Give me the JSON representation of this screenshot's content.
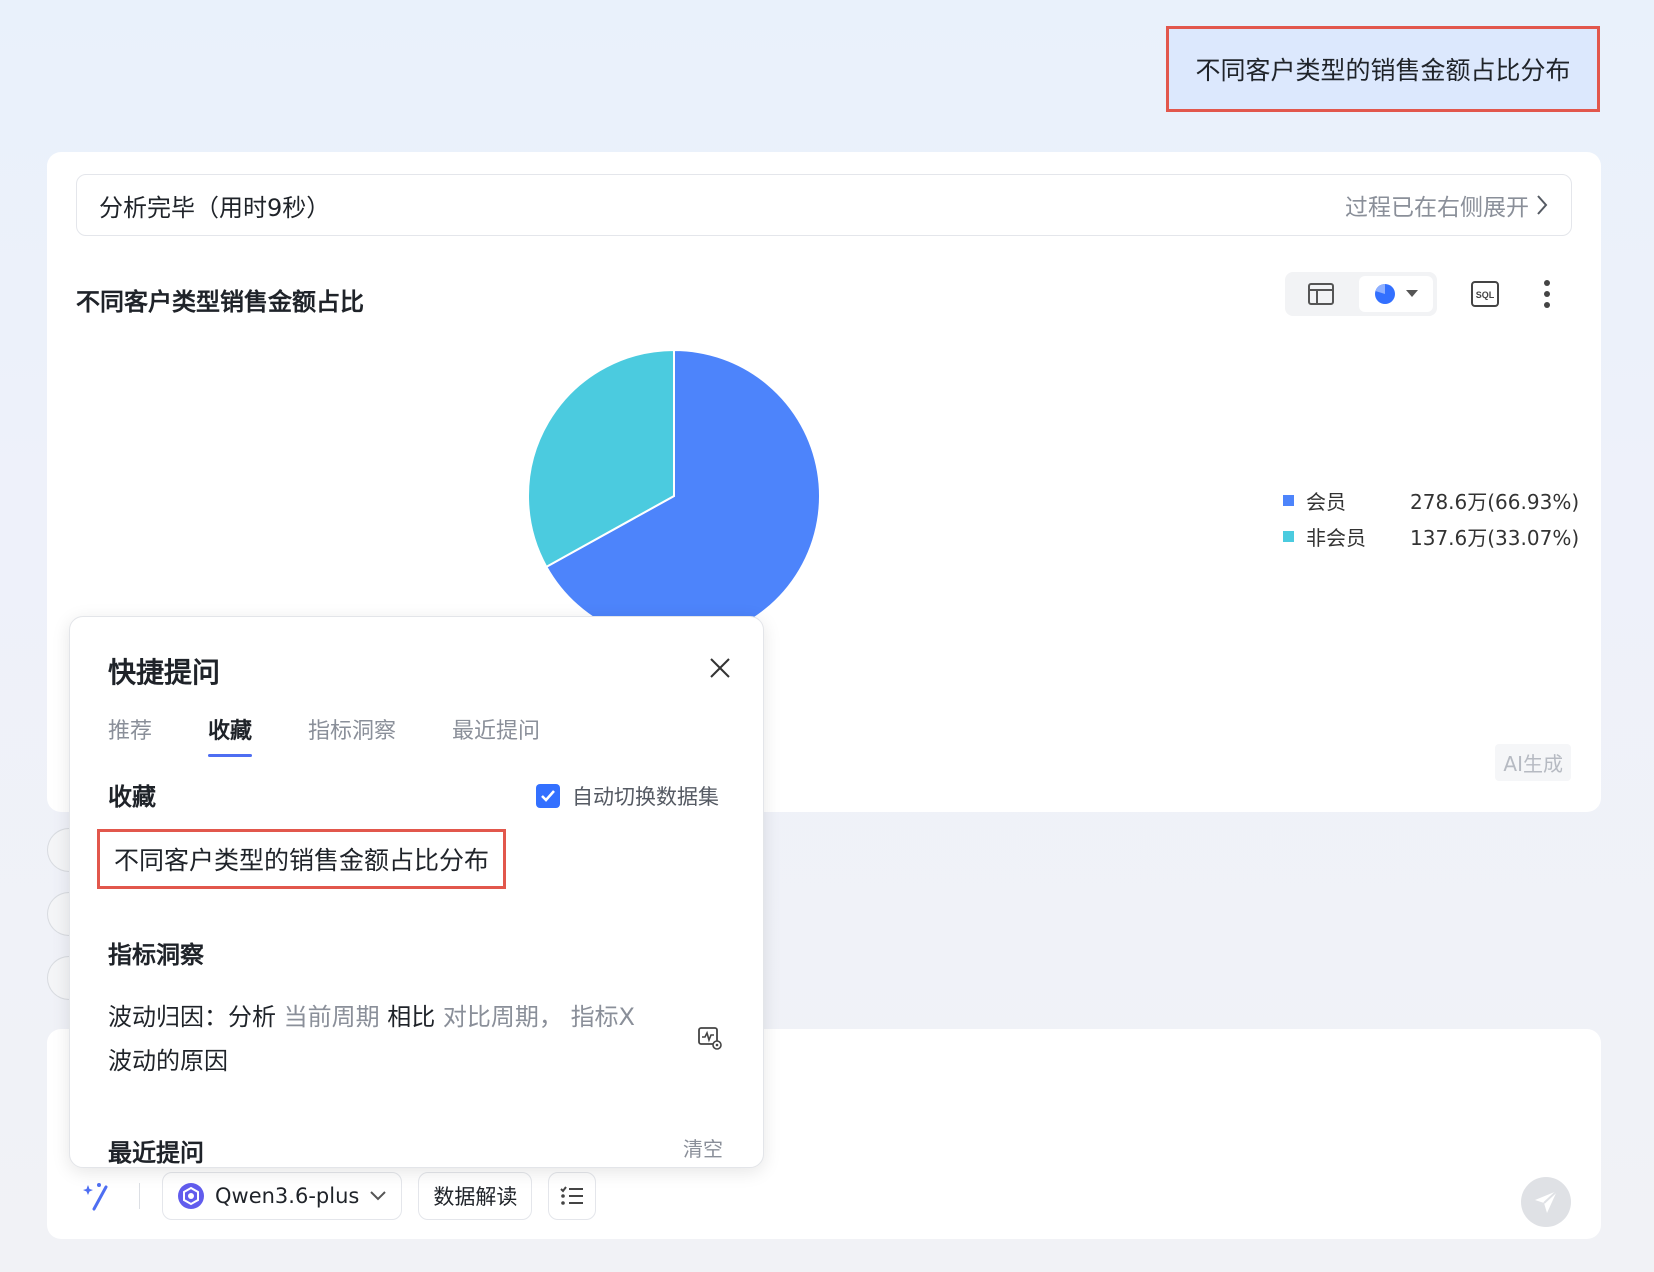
{
  "user_message": "不同客户类型的销售金额占比分布",
  "status": {
    "text": "分析完毕（用时9秒）",
    "link": "过程已在右侧展开"
  },
  "chart": {
    "title": "不同客户类型销售金额占比",
    "sql_label": "SQL",
    "ai_tag": "AI生成"
  },
  "chart_data": {
    "type": "pie",
    "title": "不同客户类型销售金额占比",
    "slices": [
      {
        "name": "会员",
        "value": 278.6,
        "display": "278.6万(66.93%)",
        "percent": 66.93,
        "color": "#4d84fb"
      },
      {
        "name": "非会员",
        "value": 137.6,
        "display": "137.6万(33.07%)",
        "percent": 33.07,
        "color": "#4bcbdf"
      }
    ],
    "legend_position": "right"
  },
  "popup": {
    "title": "快捷提问",
    "tabs": [
      {
        "label": "推荐",
        "active": false
      },
      {
        "label": "收藏",
        "active": true
      },
      {
        "label": "指标洞察",
        "active": false
      },
      {
        "label": "最近提问",
        "active": false
      }
    ],
    "favorites_heading": "收藏",
    "auto_switch_label": "自动切换数据集",
    "auto_switch_checked": true,
    "favorite_item": "不同客户类型的销售金额占比分布",
    "insight_heading": "指标洞察",
    "insight": {
      "t1": "波动归因：分析",
      "p1": "当前周期",
      "t2": "相比",
      "p2": "对比周期，",
      "p3": "指标X",
      "t3": "波动的原因"
    },
    "cut_heading": "最近提问",
    "cut_right": "清空"
  },
  "input_toolbar": {
    "model": "Qwen3.6-plus",
    "chip1": "数据解读"
  },
  "colors": {
    "accent": "#3370ff",
    "highlight": "#e2574c",
    "bubble": "#dce8fd"
  }
}
